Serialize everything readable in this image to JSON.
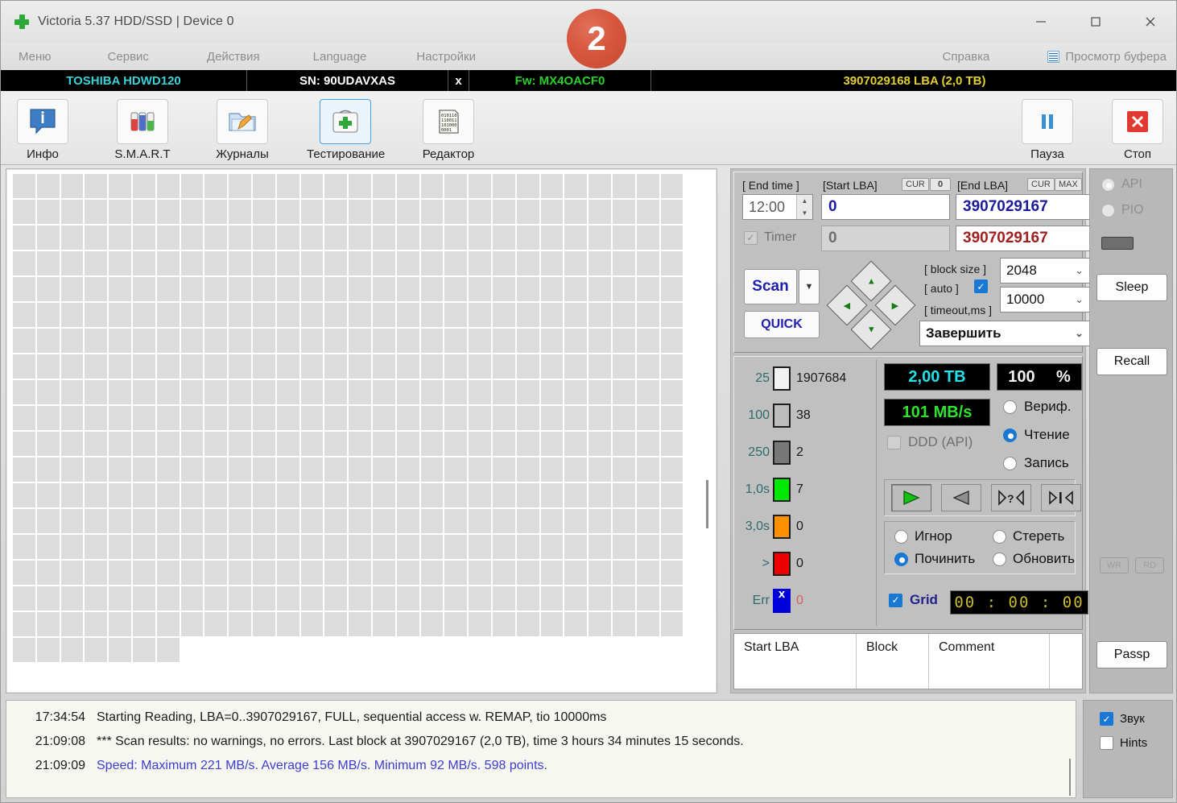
{
  "window": {
    "title": "Victoria 5.37 HDD/SSD | Device 0",
    "app_icon": "green-cross-icon",
    "badge": "2",
    "minimize": "–",
    "maximize": "□",
    "close": "✕"
  },
  "menu": {
    "items": [
      "Меню",
      "Сервис",
      "Действия",
      "Language",
      "Настройки"
    ],
    "help": "Справка",
    "buffer_view": "Просмотр буфера"
  },
  "device": {
    "model": "TOSHIBA HDWD120",
    "serial": "SN: 90UDAVXAS",
    "x": "x",
    "firmware": "Fw: MX4OACF0",
    "capacity": "3907029168 LBA (2,0 TB)"
  },
  "toolbar": {
    "buttons": [
      {
        "label": "Инфо",
        "icon": "info-icon"
      },
      {
        "label": "S.M.A.R.T",
        "icon": "smart-bars-icon"
      },
      {
        "label": "Журналы",
        "icon": "folder-pencil-icon"
      },
      {
        "label": "Тестирование",
        "icon": "test-cross-icon"
      },
      {
        "label": "Редактор",
        "icon": "binary-page-icon"
      }
    ],
    "pause": {
      "label": "Пауза",
      "icon": "pause-icon"
    },
    "stop": {
      "label": "Стоп",
      "icon": "stop-x-icon"
    }
  },
  "params": {
    "end_time_label": "[ End time ]",
    "end_time_value": "12:00",
    "timer_label": "Timer",
    "start_lba_label": "[Start LBA]",
    "start_lba_cur": "CUR",
    "start_lba_cur_value": "0",
    "start_lba_value": "0",
    "start_lba_value2": "0",
    "end_lba_label": "[End LBA]",
    "end_lba_cur": "CUR",
    "end_lba_max": "MAX",
    "end_lba_value": "3907029167",
    "end_lba_value2": "3907029167",
    "scan_button": "Scan",
    "scan_dropdown": "▼",
    "quick_button": "QUICK",
    "block_size_label": "[ block size ]",
    "block_size_value": "2048",
    "auto_label": "[ auto ]",
    "auto_checked": true,
    "timeout_label": "[ timeout,ms ]",
    "timeout_value": "10000",
    "after_action": "Завершить",
    "dpad": [
      "up",
      "left",
      "right",
      "down"
    ]
  },
  "stats": {
    "rows": [
      {
        "threshold": "25",
        "color": "#f2f2f2",
        "count": "1907684"
      },
      {
        "threshold": "100",
        "color": "#bdbdbd",
        "count": "38"
      },
      {
        "threshold": "250",
        "color": "#787878",
        "count": "2"
      },
      {
        "threshold": "1,0s",
        "color": "#00e800",
        "count": "7"
      },
      {
        "threshold": "3,0s",
        "color": "#ff9000",
        "count": "0"
      },
      {
        "threshold": ">",
        "color": "#ee0000",
        "count": "0"
      },
      {
        "threshold": "Err",
        "color": "#0000d8",
        "count": "0"
      }
    ]
  },
  "readout": {
    "capacity": "2,00 TB",
    "percent": "100",
    "percent_sign": "%",
    "speed": "101 MB/s",
    "ddd_label": "DDD (API)",
    "ddd_checked": false,
    "modes": [
      {
        "label": "Вериф.",
        "selected": false
      },
      {
        "label": "Чтение",
        "selected": true
      },
      {
        "label": "Запись",
        "selected": false
      }
    ],
    "transport": [
      {
        "name": "play-forward-icon",
        "glyph": "▶",
        "active": true
      },
      {
        "name": "play-backward-icon",
        "glyph": "◀",
        "active": false
      },
      {
        "name": "random-seek-icon",
        "glyph": "▷?◁",
        "active": false
      },
      {
        "name": "butterfly-seek-icon",
        "glyph": "▷|◁",
        "active": false
      }
    ],
    "actions": [
      {
        "label": "Игнор",
        "selected": false
      },
      {
        "label": "Стереть",
        "selected": false
      },
      {
        "label": "Починить",
        "selected": true
      },
      {
        "label": "Обновить",
        "selected": false
      }
    ],
    "grid_label": "Grid",
    "grid_checked": true,
    "timer_display": "00 : 00 : 00"
  },
  "table": {
    "headers": [
      "Start LBA",
      "Block",
      "Comment",
      ""
    ],
    "rows": []
  },
  "sidebar": {
    "api_label": "API",
    "pio_label": "PIO",
    "api_selected": true,
    "pio_selected": false,
    "sleep": "Sleep",
    "recall": "Recall",
    "wr": "WR",
    "rd": "RD",
    "passp": "Passp"
  },
  "log": {
    "entries": [
      {
        "time": "17:34:54",
        "text": "Starting Reading, LBA=0..3907029167, FULL, sequential access w. REMAP, tio 10000ms",
        "blue": false
      },
      {
        "time": "21:09:08",
        "text": "*** Scan results: no warnings, no errors. Last block at 3907029167 (2,0 TB), time 3 hours 34 minutes 15 seconds.",
        "blue": false
      },
      {
        "time": "21:09:09",
        "text": "Speed: Maximum 221 MB/s. Average 156 MB/s. Minimum 92 MB/s. 598 points.",
        "blue": true
      }
    ]
  },
  "footer": {
    "sound_label": "Звук",
    "sound_checked": true,
    "hints_label": "Hints",
    "hints_checked": false
  },
  "colors": {
    "accent": "#1878d4",
    "badge": "#d6573e",
    "lcd_cyan": "#25e2e8",
    "lcd_green": "#2ee22e",
    "device_model": "#38d3d9",
    "device_fw": "#29d12b",
    "device_lba": "#e2d02d"
  }
}
